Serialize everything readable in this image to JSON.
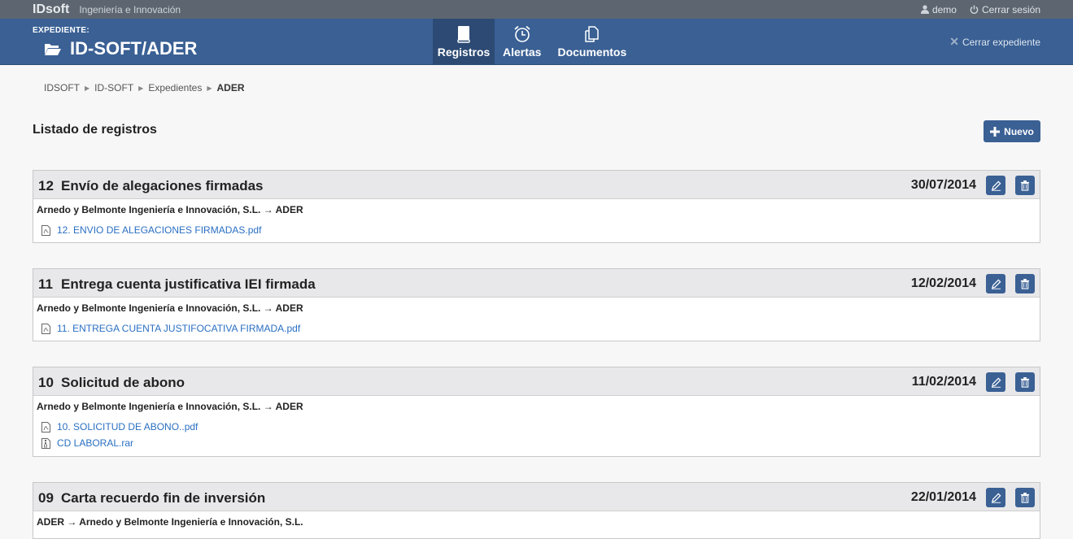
{
  "topbar": {
    "brand": "IDsoft",
    "tagline": "Ingeniería e Innovación",
    "user": "demo",
    "logout": "Cerrar sesión"
  },
  "header": {
    "label": "EXPEDIENTE:",
    "title": "ID-SOFT/ADER",
    "close": "Cerrar expediente",
    "nav": [
      {
        "label": "Registros",
        "icon": "book-icon"
      },
      {
        "label": "Alertas",
        "icon": "alarm-clock-icon"
      },
      {
        "label": "Documentos",
        "icon": "documents-icon"
      }
    ]
  },
  "breadcrumb": [
    "IDSOFT",
    "ID-SOFT",
    "Expedientes",
    "ADER"
  ],
  "main": {
    "title": "Listado de registros",
    "new_label": "Nuevo"
  },
  "records": [
    {
      "num": "12",
      "title": "Envío de alegaciones firmadas",
      "date": "30/07/2014",
      "parties": "Arnedo y Belmonte Ingeniería e Innovación, S.L. → ADER",
      "files": [
        {
          "name": "12. ENVIO DE ALEGACIONES FIRMADAS.pdf",
          "type": "pdf"
        }
      ]
    },
    {
      "num": "11",
      "title": "Entrega cuenta justificativa IEI  firmada",
      "date": "12/02/2014",
      "parties": "Arnedo y Belmonte Ingeniería e Innovación, S.L. → ADER",
      "files": [
        {
          "name": "11. ENTREGA CUENTA JUSTIFOCATIVA FIRMADA.pdf",
          "type": "pdf"
        }
      ]
    },
    {
      "num": "10",
      "title": "Solicitud de abono",
      "date": "11/02/2014",
      "parties": "Arnedo y Belmonte Ingeniería e Innovación, S.L. → ADER",
      "files": [
        {
          "name": "10. SOLICITUD DE ABONO..pdf",
          "type": "pdf"
        },
        {
          "name": "CD LABORAL.rar",
          "type": "archive"
        }
      ]
    },
    {
      "num": "09",
      "title": "Carta recuerdo fin de inversión",
      "date": "22/01/2014",
      "parties": "ADER → Arnedo y Belmonte Ingeniería e Innovación, S.L.",
      "files": []
    }
  ],
  "colors": {
    "topbar": "#5d6670",
    "header": "#3a6094",
    "nav_active": "#2c4a73",
    "link": "#2a6fc2"
  }
}
